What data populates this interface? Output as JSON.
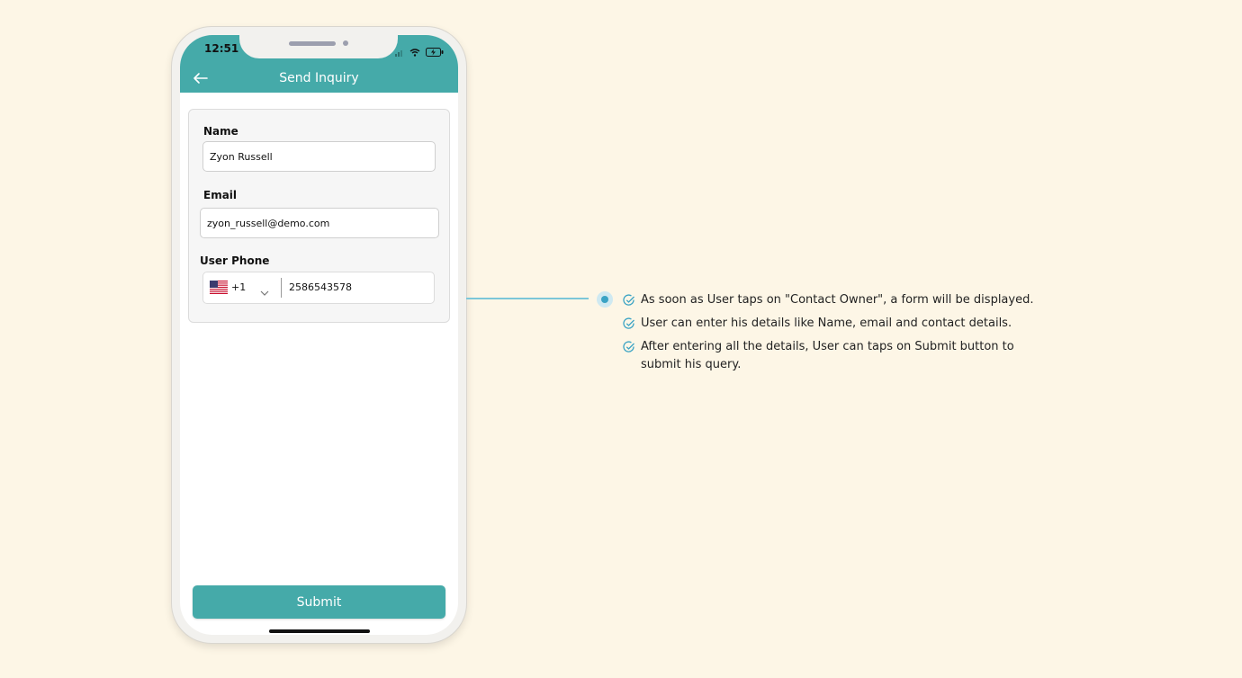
{
  "status_bar": {
    "time": "12:51"
  },
  "app_bar": {
    "title": "Send Inquiry"
  },
  "form": {
    "name_label": "Name",
    "name_value": "Zyon Russell",
    "email_label": "Email",
    "email_value": "zyon_russell@demo.com",
    "phone_label": "User Phone",
    "country_code": "+1",
    "phone_value": "2586543578"
  },
  "submit_label": "Submit",
  "notes": [
    "As soon as User taps on \"Contact Owner\", a form will be displayed.",
    "User can enter his details like Name, email and contact details.",
    "After entering all the details, User can taps on Submit button to submit his query."
  ],
  "colors": {
    "background": "#fdf6e6",
    "accent": "#45aaa9",
    "connector": "#7cc7d9"
  },
  "icons": [
    "back-arrow-icon",
    "wifi-icon",
    "signal-icon",
    "battery-icon",
    "us-flag-icon",
    "chevron-down-icon",
    "check-circle-icon"
  ]
}
